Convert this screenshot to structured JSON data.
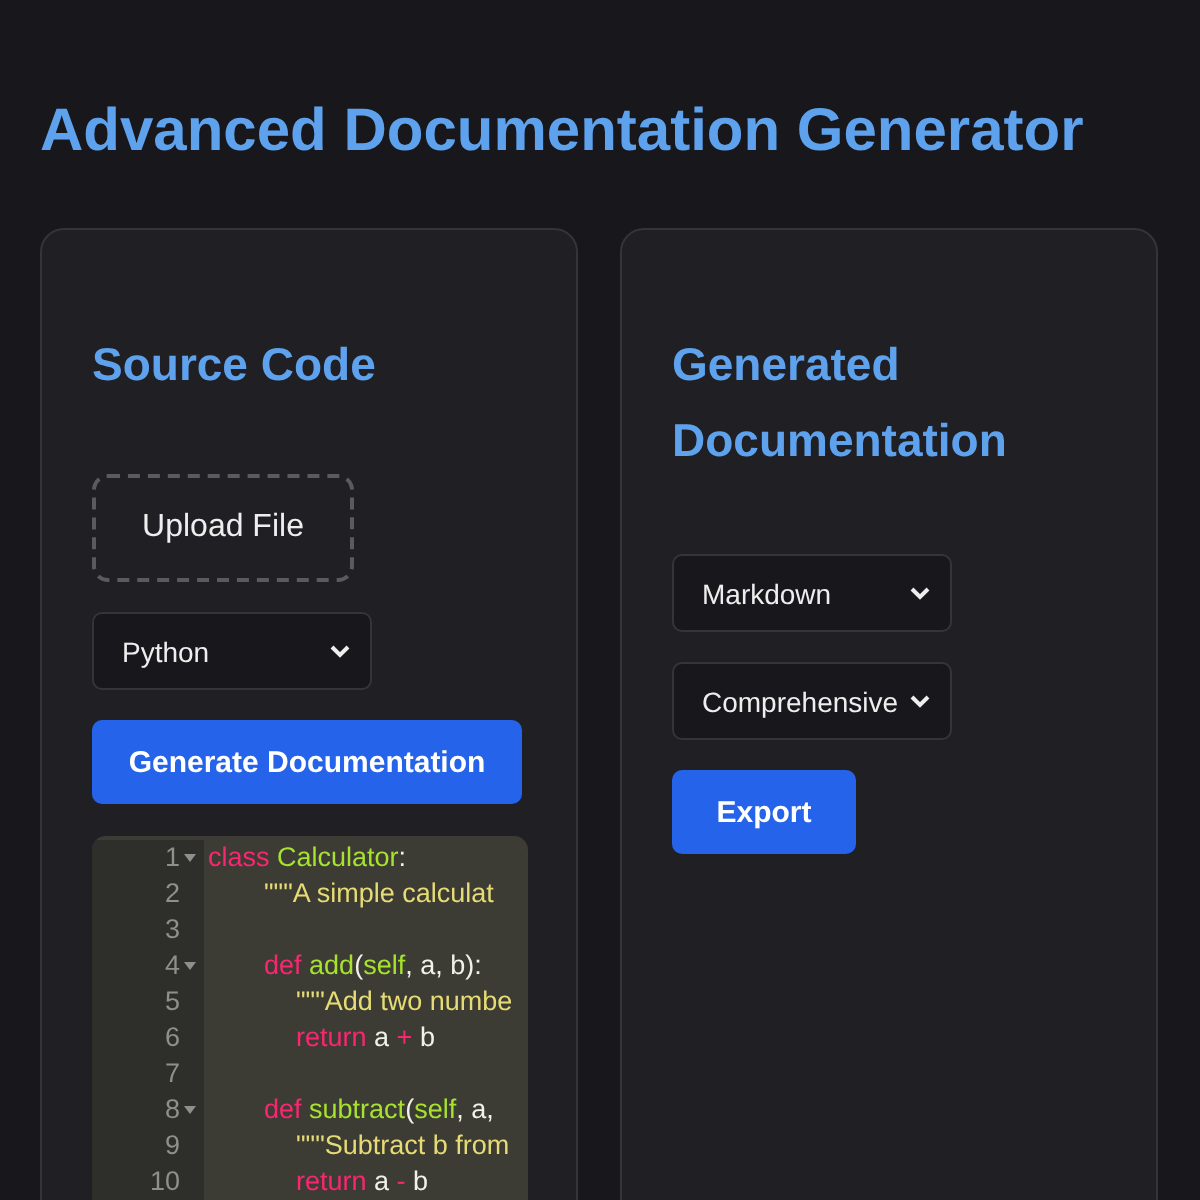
{
  "title": "Advanced Documentation Generator",
  "source_panel": {
    "heading": "Source Code",
    "upload_button": "Upload File",
    "language_select": "Python",
    "generate_button": "Generate Documentation",
    "code_lines": [
      {
        "number": "1",
        "foldable": true,
        "tokens": [
          {
            "kind": "keyword",
            "text": "class"
          },
          {
            "kind": "name",
            "text": " Calculator"
          },
          {
            "kind": "plain",
            "text": ":"
          }
        ],
        "children": [
          {
            "number": "2",
            "foldable": false,
            "tokens": [
              {
                "kind": "string",
                "text": "\"\"\"A simple calculat"
              }
            ]
          },
          {
            "number": "3",
            "foldable": false
          },
          {
            "number": "4",
            "foldable": true,
            "tokens": [
              {
                "kind": "keyword",
                "text": "def"
              },
              {
                "kind": "name",
                "text": " add"
              },
              {
                "kind": "plain",
                "text": "("
              },
              {
                "kind": "name",
                "text": "self"
              },
              {
                "kind": "plain",
                "text": ", a, b):"
              }
            ],
            "children": [
              {
                "number": "5",
                "foldable": false,
                "tokens": [
                  {
                    "kind": "string",
                    "text": "\"\"\"Add two numbe"
                  }
                ]
              },
              {
                "number": "6",
                "foldable": false,
                "tokens": [
                  {
                    "kind": "keyword",
                    "text": "return"
                  },
                  {
                    "kind": "plain",
                    "text": " a "
                  },
                  {
                    "kind": "keyword",
                    "text": "+"
                  },
                  {
                    "kind": "plain",
                    "text": " b"
                  }
                ]
              }
            ]
          },
          {
            "number": "7",
            "foldable": false
          },
          {
            "number": "8",
            "foldable": true,
            "tokens": [
              {
                "kind": "keyword",
                "text": "def"
              },
              {
                "kind": "name",
                "text": " subtract"
              },
              {
                "kind": "plain",
                "text": "("
              },
              {
                "kind": "name",
                "text": "self"
              },
              {
                "kind": "plain",
                "text": ", a,"
              }
            ],
            "children": [
              {
                "number": "9",
                "foldable": false,
                "tokens": [
                  {
                    "kind": "string",
                    "text": "\"\"\"Subtract b from"
                  }
                ]
              },
              {
                "number": "10",
                "foldable": false,
                "tokens": [
                  {
                    "kind": "keyword",
                    "text": "return"
                  },
                  {
                    "kind": "plain",
                    "text": " a "
                  },
                  {
                    "kind": "keyword",
                    "text": "-"
                  },
                  {
                    "kind": "plain",
                    "text": " b"
                  }
                ]
              }
            ]
          }
        ]
      }
    ]
  },
  "output_panel": {
    "heading": "Generated Documentation",
    "format_select": "Markdown",
    "detail_select": "Comprehensive",
    "export_button": "Export"
  }
}
